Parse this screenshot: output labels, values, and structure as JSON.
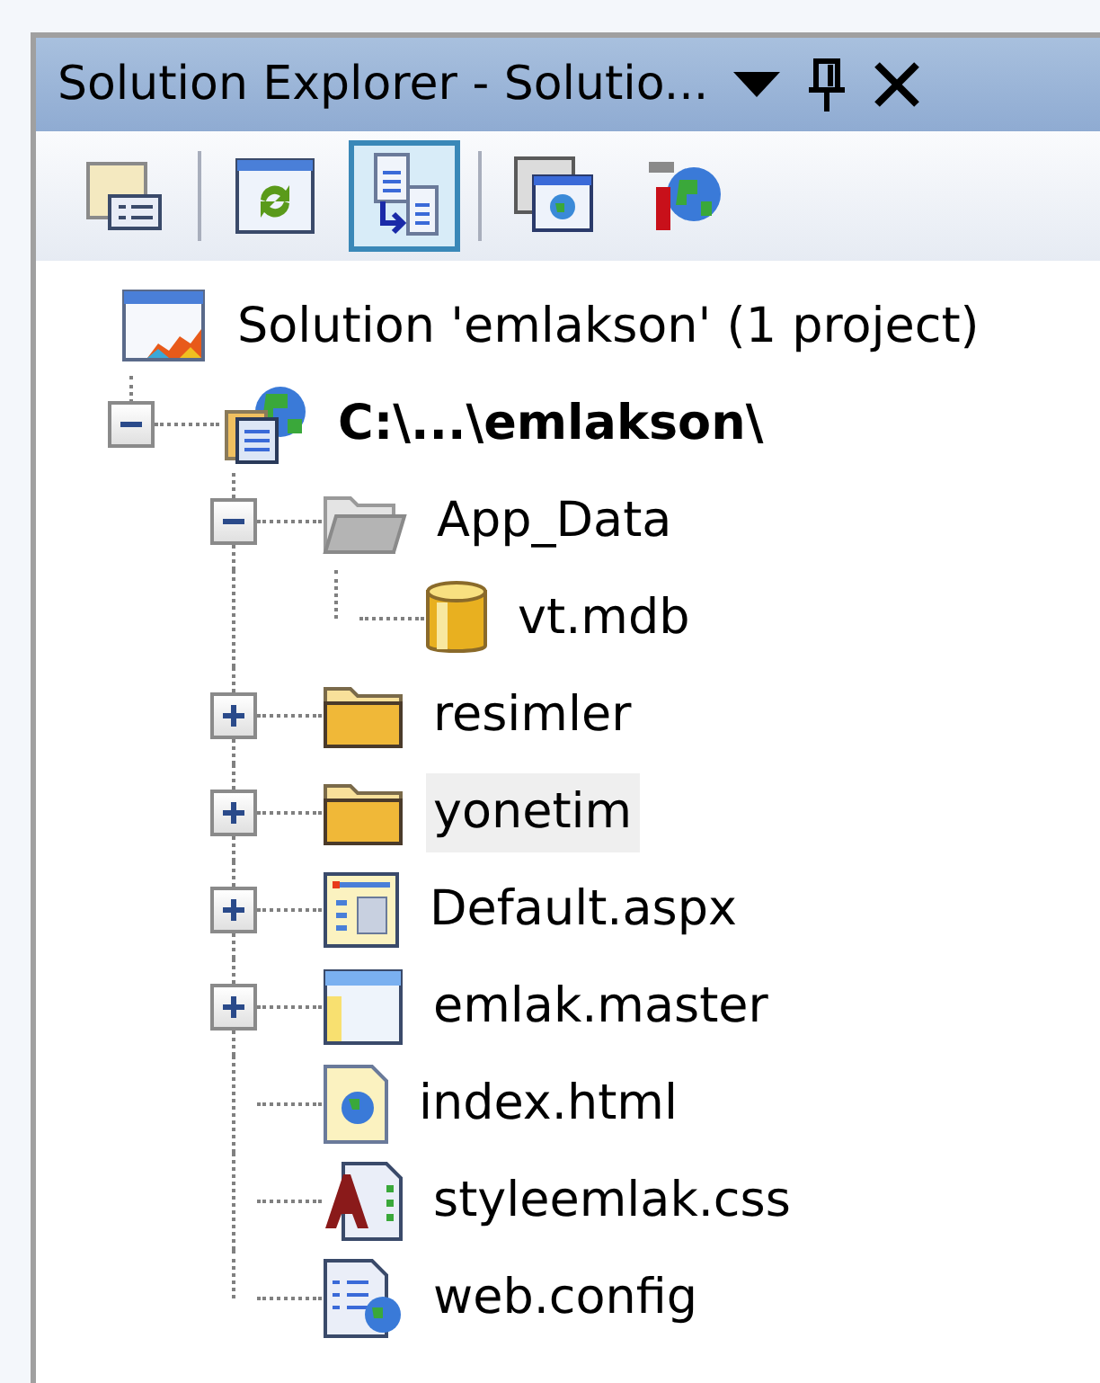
{
  "window": {
    "title": "Solution Explorer - Solutio..."
  },
  "toolbar": [
    {
      "kind": "properties",
      "selected": false
    },
    {
      "kind": "separator"
    },
    {
      "kind": "refresh",
      "selected": false
    },
    {
      "kind": "nest",
      "selected": true
    },
    {
      "kind": "separator"
    },
    {
      "kind": "view-designer",
      "selected": false
    },
    {
      "kind": "web-config-tool",
      "selected": false
    }
  ],
  "tree": [
    {
      "label": "Solution 'emlakson' (1 project)",
      "kind": "solution",
      "selected": false,
      "children": [
        {
          "label": "C:\\...\\emlakson\\",
          "kind": "project",
          "expanded": true,
          "selected": false,
          "children": [
            {
              "label": "App_Data",
              "kind": "folder-open",
              "expanded": true,
              "selected": false,
              "children": [
                {
                  "label": "vt.mdb",
                  "kind": "database",
                  "selected": false
                }
              ]
            },
            {
              "label": "resimler",
              "kind": "folder",
              "expanded": false,
              "selected": false
            },
            {
              "label": "yonetim",
              "kind": "folder",
              "expanded": false,
              "selected": true
            },
            {
              "label": "Default.aspx",
              "kind": "aspx",
              "expanded": false,
              "selected": false
            },
            {
              "label": "emlak.master",
              "kind": "master",
              "expanded": false,
              "selected": false
            },
            {
              "label": "index.html",
              "kind": "html",
              "selected": false
            },
            {
              "label": "styleemlak.css",
              "kind": "css",
              "selected": false
            },
            {
              "label": "web.config",
              "kind": "config",
              "selected": false
            }
          ]
        }
      ]
    }
  ]
}
